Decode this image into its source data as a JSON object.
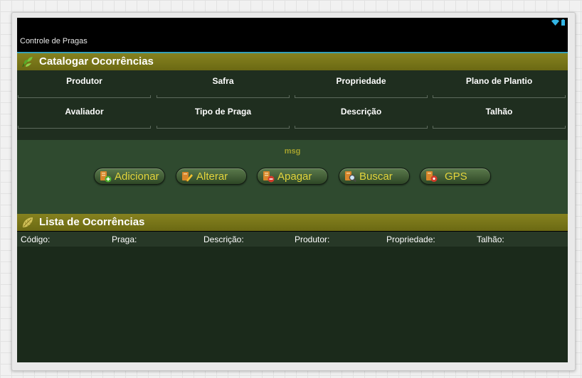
{
  "app": {
    "title": "Controle de Pragas"
  },
  "status_icons": [
    "wifi-icon",
    "battery-icon"
  ],
  "catalog": {
    "title": "Catalogar Ocorrências",
    "fields": [
      {
        "label": "Produtor"
      },
      {
        "label": "Safra"
      },
      {
        "label": "Propriedade"
      },
      {
        "label": "Plano de Plantio"
      },
      {
        "label": "Avaliador"
      },
      {
        "label": "Tipo de Praga"
      },
      {
        "label": "Descrição"
      },
      {
        "label": "Talhão"
      }
    ]
  },
  "actions": {
    "msg": "msg",
    "buttons": {
      "add": "Adicionar",
      "edit": "Alterar",
      "delete": "Apagar",
      "search": "Buscar",
      "gps": "GPS"
    }
  },
  "list": {
    "title": "Lista de Ocorrências",
    "columns": [
      "Código:",
      "Praga:",
      "Descrição:",
      "Produtor:",
      "Propriedade:",
      "Talhão:"
    ]
  },
  "colors": {
    "section_bar": "#7a781a",
    "button_text": "#e3d43c",
    "msg_text": "#a6a22e",
    "accent_rule": "#36a0b8"
  }
}
